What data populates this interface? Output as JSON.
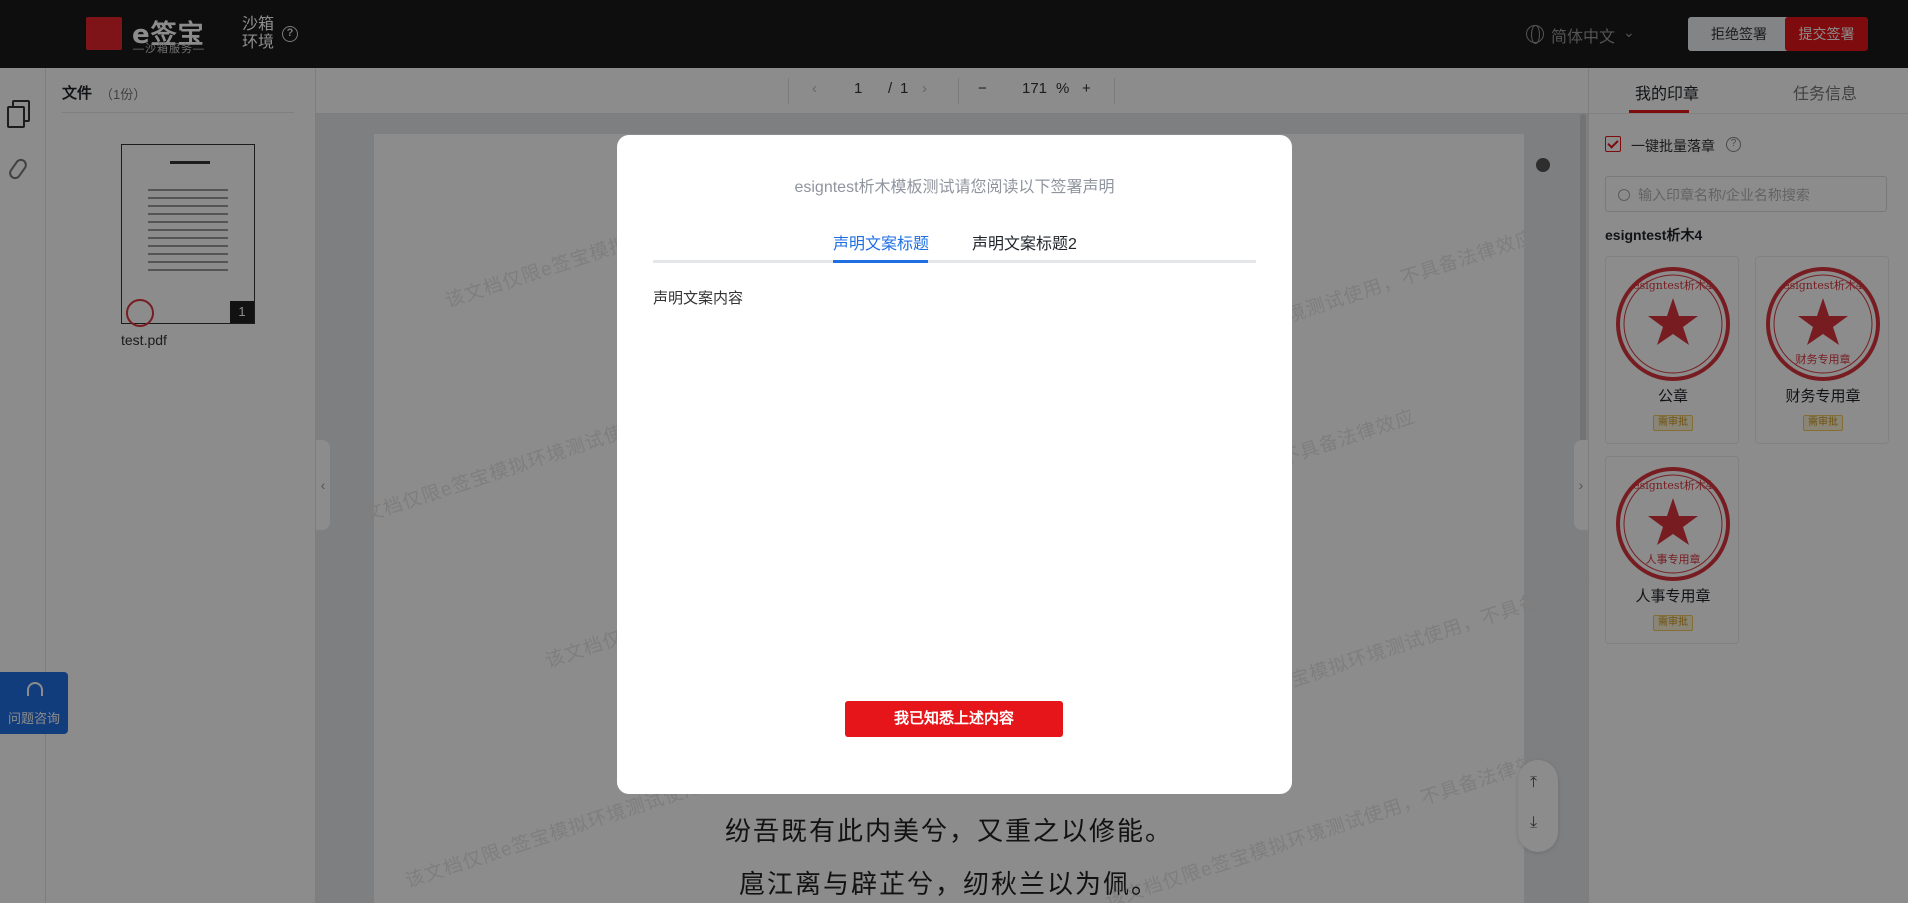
{
  "topbar": {
    "logo_text": "e签宝",
    "logo_sub": "—沙箱服务—",
    "env_label": "沙箱环境",
    "help_glyph": "?",
    "language": "简体中文",
    "reject_label": "拒绝签署",
    "submit_label": "提交签署"
  },
  "file_panel": {
    "title": "文件",
    "count": "（1份）",
    "file_name": "test.pdf",
    "page_badge": "1"
  },
  "help_float": {
    "label": "问题咨询"
  },
  "toolbar": {
    "current_page": "1",
    "page_sep": "/",
    "total_pages": "1",
    "zoom": "171",
    "zoom_unit": "%",
    "zoom_out": "−",
    "zoom_in": "+",
    "prev": "‹",
    "next": "›"
  },
  "document": {
    "watermark": "该文档仅限e签宝模拟环境测试使用，不具备法律效应",
    "lines": [
      "纷吾既有此内美兮，又重之以修能。",
      "扈江离与辟芷兮，纫秋兰以为佩。"
    ]
  },
  "right_panel": {
    "tab_my_seals": "我的印章",
    "tab_task_info": "任务信息",
    "batch_label": "一键批量落章",
    "search_placeholder": "输入印章名称/企业名称搜索",
    "org_name": "esigntest析木4",
    "seal_text": "esigntest析木4",
    "seals": [
      {
        "name": "公章",
        "badge": "需审批",
        "inner": ""
      },
      {
        "name": "财务专用章",
        "badge": "需审批",
        "inner": "财务专用章"
      },
      {
        "name": "人事专用章",
        "badge": "需审批",
        "inner": "人事专用章"
      }
    ]
  },
  "modal": {
    "title": "esigntest析木模板测试请您阅读以下签署声明",
    "tabs": [
      "声明文案标题",
      "声明文案标题2"
    ],
    "content": "声明文案内容",
    "confirm_label": "我已知悉上述内容"
  },
  "colors": {
    "brand_red": "#e5151a",
    "link_blue": "#1f6fe3",
    "seal_red": "#d9363e"
  }
}
